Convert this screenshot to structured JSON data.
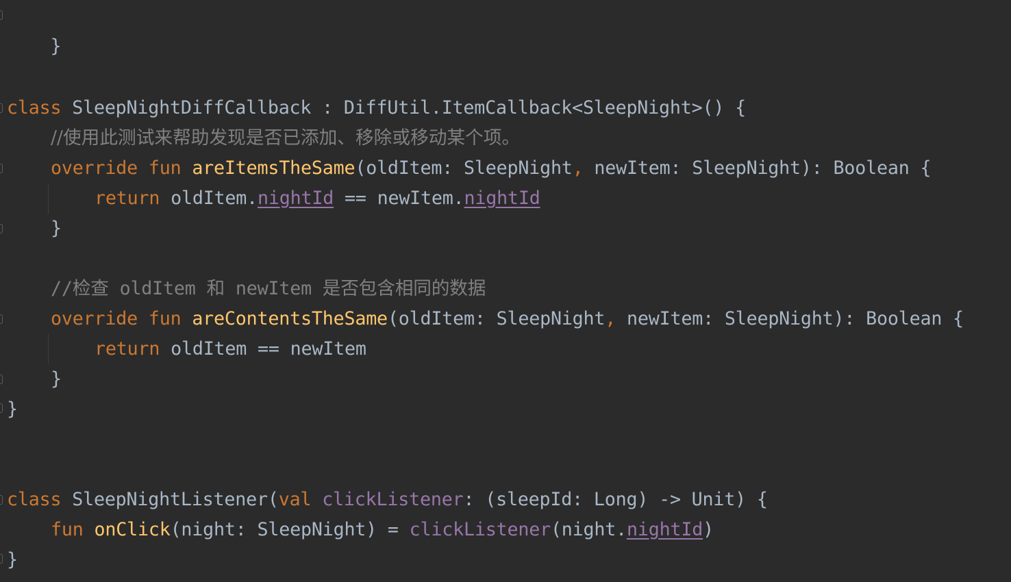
{
  "editor": {
    "theme_colors": {
      "background": "#2b2b2b",
      "text": "#a9b7c6",
      "keyword": "#cc7832",
      "function": "#ffc66d",
      "property": "#9876aa",
      "comment": "#808080"
    },
    "lines": {
      "l01": {
        "brace": "}"
      },
      "l04": {
        "kw_class": "class",
        "name": " SleepNightDiffCallback : DiffUtil.ItemCallback<SleepNight>() {"
      },
      "l05": {
        "comment": "//使用此测试来帮助发现是否已添加、移除或移动某个项。"
      },
      "l06": {
        "kw_override": "override",
        "kw_fun": "fun",
        "fn_name": "areItemsTheSame",
        "params_a": "(oldItem: SleepNight",
        "comma": ",",
        "params_b": " newItem: SleepNight): Boolean {"
      },
      "l07": {
        "kw_return": "return",
        "expr_a": " oldItem.",
        "prop_a": "nightId",
        "expr_b": " == newItem.",
        "prop_b": "nightId"
      },
      "l08": {
        "brace": "}"
      },
      "l10": {
        "comment": "//检查 oldItem 和 newItem 是否包含相同的数据"
      },
      "l11": {
        "kw_override": "override",
        "kw_fun": "fun",
        "fn_name": "areContentsTheSame",
        "params_a": "(oldItem: SleepNight",
        "comma": ",",
        "params_b": " newItem: SleepNight): Boolean {"
      },
      "l12": {
        "kw_return": "return",
        "expr": " oldItem == newItem"
      },
      "l13": {
        "brace": "}"
      },
      "l14": {
        "brace": "}"
      },
      "l17": {
        "kw_class": "class",
        "name": " SleepNightListener(",
        "kw_val": "val",
        "prop": "clickListener",
        "rest": ": (sleepId: Long) -> Unit) {"
      },
      "l18": {
        "kw_fun": "fun",
        "fn_name": "onClick",
        "params": "(night: SleepNight) = ",
        "prop_call": "clickListener",
        "args_a": "(night.",
        "prop_u": "nightId",
        "args_b": ")"
      },
      "l19": {
        "brace": "}"
      }
    }
  }
}
